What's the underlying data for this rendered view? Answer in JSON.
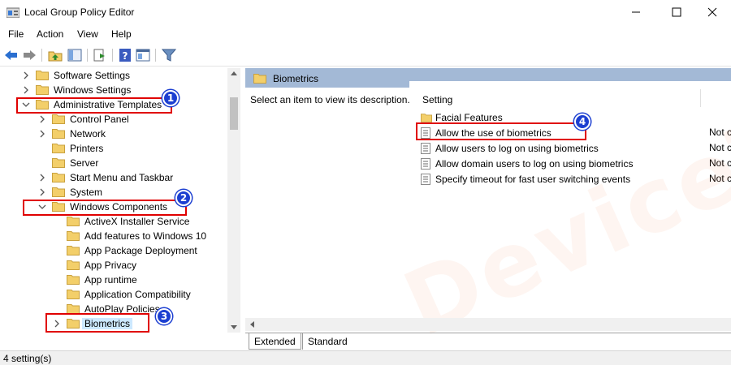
{
  "window": {
    "title": "Local Group Policy Editor"
  },
  "menu": [
    "File",
    "Action",
    "View",
    "Help"
  ],
  "tree": {
    "items": [
      {
        "label": "Software Settings"
      },
      {
        "label": "Windows Settings"
      },
      {
        "label": "Administrative Templates"
      },
      {
        "label": "Control Panel"
      },
      {
        "label": "Network"
      },
      {
        "label": "Printers"
      },
      {
        "label": "Server"
      },
      {
        "label": "Start Menu and Taskbar"
      },
      {
        "label": "System"
      },
      {
        "label": "Windows Components"
      },
      {
        "label": "ActiveX Installer Service"
      },
      {
        "label": "Add features to Windows 10"
      },
      {
        "label": "App Package Deployment"
      },
      {
        "label": "App Privacy"
      },
      {
        "label": "App runtime"
      },
      {
        "label": "Application Compatibility"
      },
      {
        "label": "AutoPlay Policies"
      },
      {
        "label": "Biometrics"
      }
    ]
  },
  "badges": [
    "1",
    "2",
    "3",
    "4"
  ],
  "details": {
    "header": "Biometrics",
    "description": "Select an item to view its description.",
    "column": "Setting",
    "rows": [
      {
        "label": "Facial Features",
        "state": ""
      },
      {
        "label": "Allow the use of biometrics",
        "state": "Not c"
      },
      {
        "label": "Allow users to log on using biometrics",
        "state": "Not c"
      },
      {
        "label": "Allow domain users to log on using biometrics",
        "state": "Not c"
      },
      {
        "label": "Specify timeout for fast user switching events",
        "state": "Not c"
      }
    ]
  },
  "tabs": [
    "Extended",
    "Standard"
  ],
  "status": "4 setting(s)",
  "watermark": "DeviceTricks",
  "colors": {
    "badge": "#1c3fd1",
    "highlight_border": "#e00000",
    "header_bg": "#a3b9d6",
    "folder": "#f3cf6a"
  }
}
